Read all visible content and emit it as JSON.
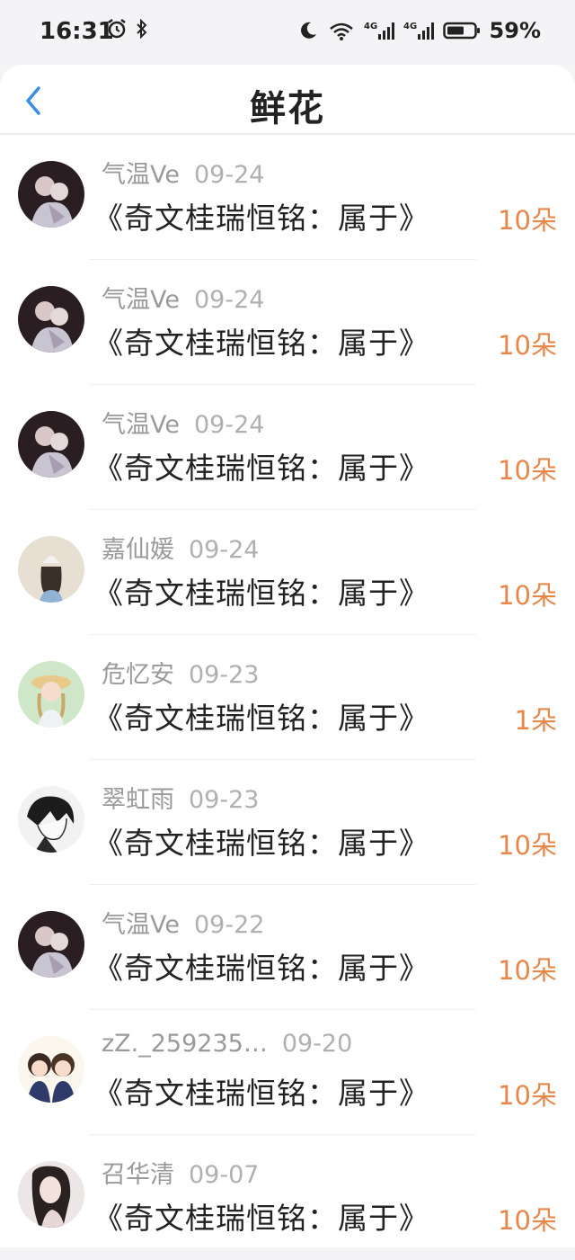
{
  "status": {
    "time": "16:31",
    "battery": "59%"
  },
  "header": {
    "title": "鲜花"
  },
  "items": [
    {
      "user": "气温Ve",
      "date": "09-24",
      "title": "《奇文桂瑞恒铭：属于》",
      "count": "10朵",
      "avatar": "couple-dark"
    },
    {
      "user": "气温Ve",
      "date": "09-24",
      "title": "《奇文桂瑞恒铭：属于》",
      "count": "10朵",
      "avatar": "couple-dark"
    },
    {
      "user": "气温Ve",
      "date": "09-24",
      "title": "《奇文桂瑞恒铭：属于》",
      "count": "10朵",
      "avatar": "couple-dark"
    },
    {
      "user": "嘉仙媛",
      "date": "09-24",
      "title": "《奇文桂瑞恒铭：属于》",
      "count": "10朵",
      "avatar": "girl-beige"
    },
    {
      "user": "危忆安",
      "date": "09-23",
      "title": "《奇文桂瑞恒铭：属于》",
      "count": "1朵",
      "avatar": "girl-green"
    },
    {
      "user": "翠虹雨",
      "date": "09-23",
      "title": "《奇文桂瑞恒铭：属于》",
      "count": "10朵",
      "avatar": "manga-bw"
    },
    {
      "user": "气温Ve",
      "date": "09-22",
      "title": "《奇文桂瑞恒铭：属于》",
      "count": "10朵",
      "avatar": "couple-dark"
    },
    {
      "user": "zZ._259235…",
      "date": "09-20",
      "title": "《奇文桂瑞恒铭：属于》",
      "count": "10朵",
      "avatar": "cartoon-pair"
    },
    {
      "user": "召华清",
      "date": "09-07",
      "title": "《奇文桂瑞恒铭：属于》",
      "count": "10朵",
      "avatar": "girl-photo"
    }
  ],
  "colors": {
    "accent": "#e8874a",
    "back": "#3a8ee6",
    "meta": "#9a9a9a"
  }
}
